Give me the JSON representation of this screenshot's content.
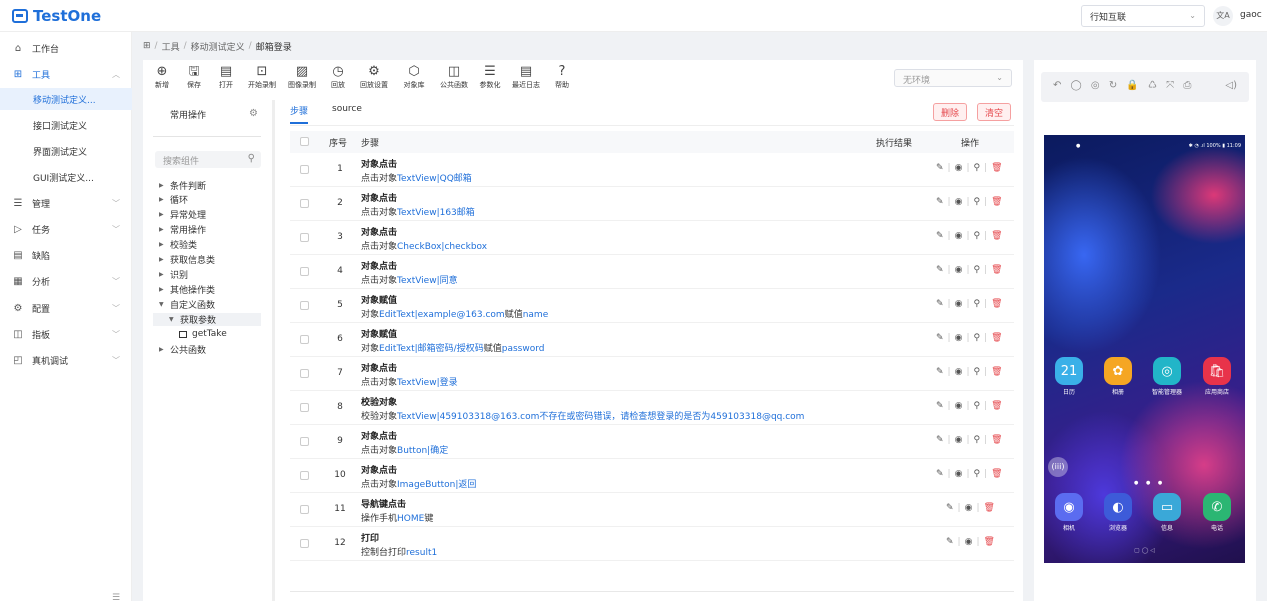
{
  "app": {
    "title": "TestOne"
  },
  "header": {
    "org": "行知互联",
    "lang_icon": "translate-icon",
    "user": "gaoc"
  },
  "sidebar": {
    "items": [
      {
        "label": "工作台",
        "icon": "home-icon"
      },
      {
        "label": "工具",
        "icon": "grid-icon"
      },
      {
        "label": "管理",
        "icon": "list-icon"
      },
      {
        "label": "任务",
        "icon": "play-icon"
      },
      {
        "label": "缺陷",
        "icon": "file-icon"
      },
      {
        "label": "分析",
        "icon": "calendar-icon"
      },
      {
        "label": "配置",
        "icon": "gear-icon"
      },
      {
        "label": "指板",
        "icon": "board-icon"
      },
      {
        "label": "真机调试",
        "icon": "device-icon"
      }
    ],
    "sub_items": [
      {
        "label": "移动测试定义..."
      },
      {
        "label": "接口测试定义"
      },
      {
        "label": "界面测试定义"
      },
      {
        "label": "GUI测试定义..."
      }
    ]
  },
  "breadcrumb": {
    "home": "⊞",
    "items": [
      "工具",
      "移动测试定义",
      "邮箱登录"
    ]
  },
  "toolbar": {
    "tools": [
      {
        "label": "新增",
        "icon": "⊕"
      },
      {
        "label": "保存",
        "icon": "🖫"
      },
      {
        "label": "打开",
        "icon": "▤"
      },
      {
        "label": "开始录制",
        "icon": "⊡"
      },
      {
        "label": "图像录制",
        "icon": "▨"
      },
      {
        "label": "回放",
        "icon": "◷"
      },
      {
        "label": "回放设置",
        "icon": "⚙"
      },
      {
        "label": "对象库",
        "icon": "⬡"
      },
      {
        "label": "公共函数",
        "icon": "◫"
      },
      {
        "label": "参数化",
        "icon": "☰"
      },
      {
        "label": "最近日志",
        "icon": "▤"
      },
      {
        "label": "帮助",
        "icon": "?"
      }
    ],
    "env": "无环境"
  },
  "components": {
    "title": "常用操作",
    "search_placeholder": "搜索组件",
    "tree": [
      {
        "label": "条件判断"
      },
      {
        "label": "循环"
      },
      {
        "label": "异常处理"
      },
      {
        "label": "常用操作"
      },
      {
        "label": "校验类"
      },
      {
        "label": "获取信息类"
      },
      {
        "label": "识别"
      },
      {
        "label": "其他操作类"
      },
      {
        "label": "自定义函数"
      },
      {
        "label": "获取参数"
      },
      {
        "label": "getTake"
      },
      {
        "label": "公共函数"
      }
    ]
  },
  "tabs": [
    {
      "label": "步骤"
    },
    {
      "label": "source"
    }
  ],
  "actions": {
    "delete": "删除",
    "clear": "清空"
  },
  "grid": {
    "headers": {
      "index": "序号",
      "step": "步骤",
      "result": "执行结果",
      "ops": "操作"
    },
    "rows": [
      {
        "num": "1",
        "title": "对象点击",
        "d": [
          "点击对象",
          "TextView|QQ邮箱",
          ""
        ]
      },
      {
        "num": "2",
        "title": "对象点击",
        "d": [
          "点击对象",
          "TextView|163邮箱",
          ""
        ]
      },
      {
        "num": "3",
        "title": "对象点击",
        "d": [
          "点击对象",
          "CheckBox|checkbox",
          ""
        ]
      },
      {
        "num": "4",
        "title": "对象点击",
        "d": [
          "点击对象",
          "TextView|同意",
          ""
        ]
      },
      {
        "num": "5",
        "title": "对象赋值",
        "d": [
          "对象",
          "EditText|example@163.com",
          "赋值",
          "name"
        ]
      },
      {
        "num": "6",
        "title": "对象赋值",
        "d": [
          "对象",
          "EditText|邮箱密码/授权码",
          "赋值",
          "password"
        ]
      },
      {
        "num": "7",
        "title": "对象点击",
        "d": [
          "点击对象",
          "TextView|登录",
          ""
        ]
      },
      {
        "num": "8",
        "title": "校验对象",
        "d": [
          "校验对象",
          "TextView|459103318@163.com不存在或密码错误，请检查想登录的是否为459103318@qq.com",
          ""
        ]
      },
      {
        "num": "9",
        "title": "对象点击",
        "d": [
          "点击对象",
          "Button|确定",
          ""
        ]
      },
      {
        "num": "10",
        "title": "对象点击",
        "d": [
          "点击对象",
          "ImageButton|返回",
          ""
        ]
      },
      {
        "num": "11",
        "title": "导航键点击",
        "d": [
          "操作手机",
          "HOME",
          "键"
        ]
      },
      {
        "num": "12",
        "title": "打印",
        "d": [
          "控制台打印",
          "result1",
          ""
        ]
      }
    ],
    "op_edit": "✎",
    "op_run": "◉",
    "op_search": "⚲",
    "op_delete": "🗑"
  },
  "device": {
    "toolbar_icons": "↶ ◯ ◎ ↻ 🔒 ♺ ⤧ ⎙",
    "volume": "◁)",
    "status_left": "●",
    "status_right": "✱ ◔ .ıl 100% ▮ 11:09",
    "apps_row1": [
      {
        "label": "日历",
        "glyph": "21"
      },
      {
        "label": "相册",
        "glyph": "✿"
      },
      {
        "label": "智能管理器",
        "glyph": "◎"
      },
      {
        "label": "应用商店",
        "glyph": "🛍"
      }
    ],
    "apps_row2": [
      {
        "label": "相机",
        "glyph": "◉"
      },
      {
        "label": "浏览器",
        "glyph": "◐"
      },
      {
        "label": "信息",
        "glyph": "▭"
      },
      {
        "label": "电话",
        "glyph": "✆"
      }
    ],
    "float": "(iii)",
    "dots": "● ● ●",
    "nav": "▢        ◯        ◁"
  }
}
